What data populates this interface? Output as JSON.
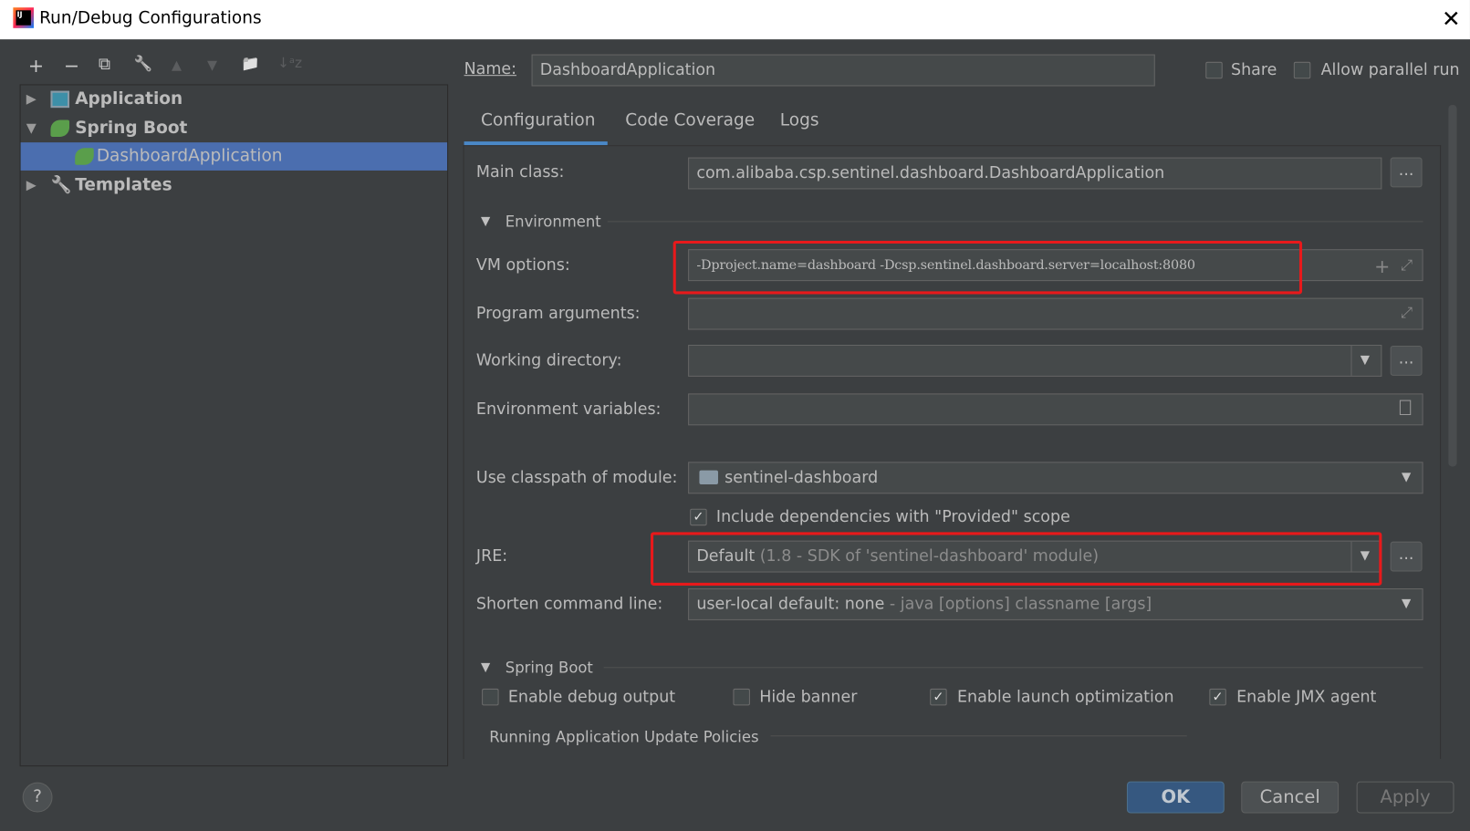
{
  "window": {
    "title": "Run/Debug Configurations",
    "close": "✕"
  },
  "toolbar": {
    "add": "+",
    "remove": "−",
    "copy": "⧉",
    "edit": "🔧",
    "up": "▲",
    "down": "▼",
    "folder": "📁",
    "sort": "↓ᵃz"
  },
  "tree": {
    "items": [
      {
        "label": "Application",
        "expanded": false,
        "icon": "application-icon"
      },
      {
        "label": "Spring Boot",
        "expanded": true,
        "icon": "spring-boot-icon"
      },
      {
        "label": "DashboardApplication",
        "selected": true,
        "icon": "spring-boot-icon"
      },
      {
        "label": "Templates",
        "expanded": false,
        "icon": "wrench-icon"
      }
    ]
  },
  "header": {
    "name_label": "Name:",
    "name_value": "DashboardApplication",
    "share_label": "Share",
    "share": false,
    "parallel_label": "Allow parallel run",
    "parallel": false
  },
  "tabs": [
    {
      "label": "Configuration",
      "active": true
    },
    {
      "label": "Code Coverage"
    },
    {
      "label": "Logs"
    }
  ],
  "config": {
    "main_class_label": "Main class:",
    "main_class": "com.alibaba.csp.sentinel.dashboard.DashboardApplication",
    "environment_section": "Environment",
    "vm_options_label": "VM options:",
    "vm_options": "-Dproject.name=dashboard -Dcsp.sentinel.dashboard.server=localhost:8080",
    "program_args_label": "Program arguments:",
    "program_args": "",
    "working_dir_label": "Working directory:",
    "working_dir": "",
    "env_vars_label": "Environment variables:",
    "env_vars": "",
    "classpath_label": "Use classpath of module:",
    "classpath": "sentinel-dashboard",
    "include_deps_label": "Include dependencies with \"Provided\" scope",
    "include_deps": true,
    "jre_label": "JRE:",
    "jre_value": "Default",
    "jre_hint": "(1.8 - SDK of 'sentinel-dashboard' module)",
    "shorten_label": "Shorten command line:",
    "shorten_value": "user-local default: none",
    "shorten_hint": "- java [options] classname [args]",
    "spring_section": "Spring Boot",
    "debug_label": "Enable debug output",
    "debug": false,
    "banner_label": "Hide banner",
    "banner": false,
    "launch_opt_label": "Enable launch optimization",
    "launch_opt": true,
    "jmx_label": "Enable JMX agent",
    "jmx": true,
    "update_policies": "Running Application Update Policies",
    "dots": "..."
  },
  "footer": {
    "help": "?",
    "ok": "OK",
    "cancel": "Cancel",
    "apply": "Apply"
  },
  "colors": {
    "background": "#3c3f41",
    "selection": "#4b6eaf",
    "highlight": "#e8191b",
    "ok": "#365880"
  }
}
